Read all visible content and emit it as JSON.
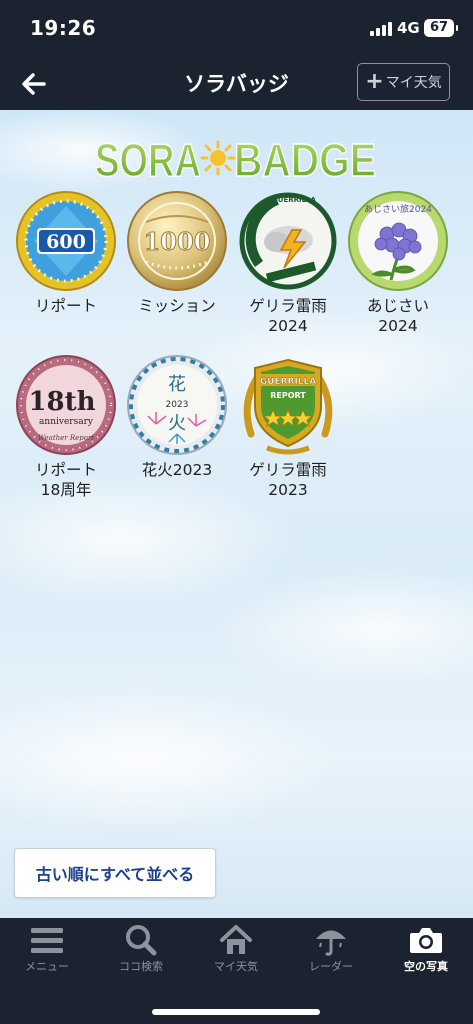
{
  "status_bar": {
    "time": "19:26",
    "network": "4G",
    "battery": "67"
  },
  "header": {
    "title": "ソラバッジ",
    "back_icon": "arrow-left-icon",
    "my_weather_button": "マイ天気"
  },
  "logo": {
    "text_left": "SORA",
    "text_right": "BADGE"
  },
  "badges": [
    {
      "label": "リポート",
      "badge_text": "600"
    },
    {
      "label": "ミッション",
      "badge_text": "1000"
    },
    {
      "label": "ゲリラ雷雨\n2024",
      "badge_text": "GUERRILLA"
    },
    {
      "label": "あじさい\n2024",
      "badge_text": "あじさい旅2024"
    },
    {
      "label": "リポート\n18周年",
      "badge_text": "18th",
      "badge_subtext": "anniversary",
      "badge_footer": "Weather Report"
    },
    {
      "label": "花火2023",
      "badge_text": "花",
      "badge_text2": "火",
      "badge_year": "2023"
    },
    {
      "label": "ゲリラ雷雨\n2023",
      "badge_text": "GUERRILLA",
      "badge_subtext": "REPORT"
    }
  ],
  "sort_button": "古い順にすべて並べる",
  "tabs": [
    {
      "label": "メニュー",
      "icon": "menu-icon",
      "active": false
    },
    {
      "label": "ココ検索",
      "icon": "search-icon",
      "active": false
    },
    {
      "label": "マイ天気",
      "icon": "home-icon",
      "active": false
    },
    {
      "label": "レーダー",
      "icon": "umbrella-icon",
      "active": false
    },
    {
      "label": "空の写真",
      "icon": "camera-icon",
      "active": true
    }
  ],
  "colors": {
    "bar_background": "#1b2230",
    "logo_green": "#8cc63f",
    "sort_button_text": "#1c3f8f"
  }
}
